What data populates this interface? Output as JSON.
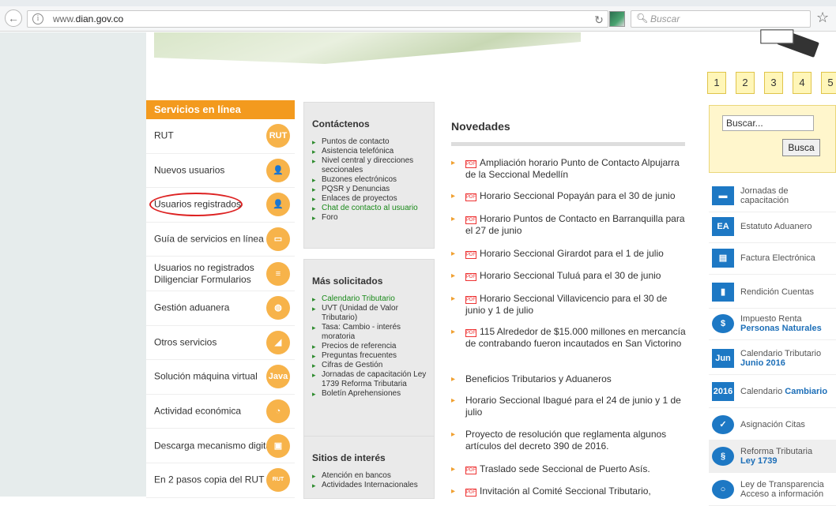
{
  "browser": {
    "url_prefix": "www.",
    "url_domain": "dian.gov.co",
    "search_placeholder": "Buscar"
  },
  "pager": [
    "1",
    "2",
    "3",
    "4",
    "5"
  ],
  "services": {
    "header": "Servicios en línea",
    "items": [
      {
        "label": "RUT",
        "icon": "RUT"
      },
      {
        "label": "Nuevos usuarios",
        "icon": "👤"
      },
      {
        "label": "Usuarios registrados",
        "icon": "👤"
      },
      {
        "label": "Guía de servicios en línea",
        "icon": "▭"
      },
      {
        "label": "Usuarios no registrados\nDiligenciar Formularios",
        "icon": "≡"
      },
      {
        "label": "Gestión aduanera",
        "icon": "◍"
      },
      {
        "label": "Otros servicios",
        "icon": "◢"
      },
      {
        "label": "Solución máquina virtual",
        "icon": "Java"
      },
      {
        "label": "Actividad económica",
        "icon": "◔"
      },
      {
        "label": "Descarga mecanismo digital",
        "icon": "▣"
      },
      {
        "label": "En 2 pasos copia del RUT",
        "icon": "RUT"
      }
    ]
  },
  "contactenos": {
    "title": "Contáctenos",
    "items": [
      "Puntos de contacto",
      "Asistencia telefónica",
      "Nivel central y direcciones seccionales",
      "Buzones electrónicos",
      "PQSR y Denuncias",
      "Enlaces de proyectos",
      "Chat de contacto al usuario",
      "Foro"
    ]
  },
  "mas_solicitados": {
    "title": "Más solicitados",
    "items": [
      "Calendario Tributario",
      "UVT (Unidad de Valor Tributario)",
      "Tasa: Cambio - interés moratoria",
      "Precios de referencia",
      "Preguntas frecuentes",
      "Cifras de Gestión",
      "Jornadas de capacitación Ley 1739 Reforma Tributaria",
      "Boletín Aprehensiones"
    ]
  },
  "sitios": {
    "title": "Sitios de interés",
    "items": [
      "Atención en bancos",
      "Actividades Internacionales"
    ]
  },
  "novedades": {
    "title": "Novedades",
    "items": [
      {
        "pdf": true,
        "text": "Ampliación horario Punto de Contacto Alpujarra de la Seccional Medellín"
      },
      {
        "pdf": true,
        "text": "Horario Seccional Popayán para el 30 de junio"
      },
      {
        "pdf": true,
        "text": "Horario Puntos de Contacto en Barranquilla para el 27 de junio"
      },
      {
        "pdf": true,
        "text": "Horario Seccional Girardot para el 1 de julio"
      },
      {
        "pdf": true,
        "text": "Horario Seccional Tuluá para el 30 de junio"
      },
      {
        "pdf": true,
        "text": "Horario Seccional Villavicencio para el 30 de junio y 1 de julio"
      },
      {
        "pdf": true,
        "text": "115 Alrededor de $15.000 millones en mercancía de contrabando fueron incautados en San Victorino"
      },
      {
        "pdf": false,
        "text": "Beneficios Tributarios y Aduaneros"
      },
      {
        "pdf": false,
        "text": "Horario Seccional Ibagué para el 24 de junio y 1 de julio"
      },
      {
        "pdf": false,
        "text": "Proyecto de resolución que reglamenta algunos artículos del decreto 390 de 2016."
      },
      {
        "pdf": true,
        "text": "Traslado sede Seccional de Puerto Asís."
      },
      {
        "pdf": true,
        "text": "Invitación al Comité Seccional Tributario,"
      }
    ]
  },
  "search": {
    "placeholder": "Buscar...",
    "button": "Busca"
  },
  "right_links": [
    {
      "icon": "▬",
      "line1": "Jornadas de",
      "line2": "capacitación",
      "bold": ""
    },
    {
      "icon": "EA",
      "line1": "Estatuto Aduanero",
      "line2": "",
      "bold": ""
    },
    {
      "icon": "▤",
      "line1": "Factura Electrónica",
      "line2": "",
      "bold": ""
    },
    {
      "icon": "▮",
      "line1": "Rendición Cuentas",
      "line2": "",
      "bold": ""
    },
    {
      "icon": "$",
      "line1": "Impuesto Renta",
      "line2": "",
      "bold": "Personas Naturales"
    },
    {
      "icon": "Jun",
      "line1": "Calendario Tributario",
      "line2": "",
      "bold": "Junio 2016"
    },
    {
      "icon": "2016",
      "line1": "Calendario",
      "line2": "",
      "bold": "Cambiario"
    },
    {
      "icon": "✓",
      "line1": "Asignación Citas",
      "line2": "",
      "bold": ""
    },
    {
      "icon": "§",
      "line1": "Reforma Tributaria",
      "line2": "",
      "bold": "Ley 1739"
    },
    {
      "icon": "○",
      "line1": "Ley de Transparencia",
      "line2": "Acceso a información",
      "bold": ""
    }
  ]
}
